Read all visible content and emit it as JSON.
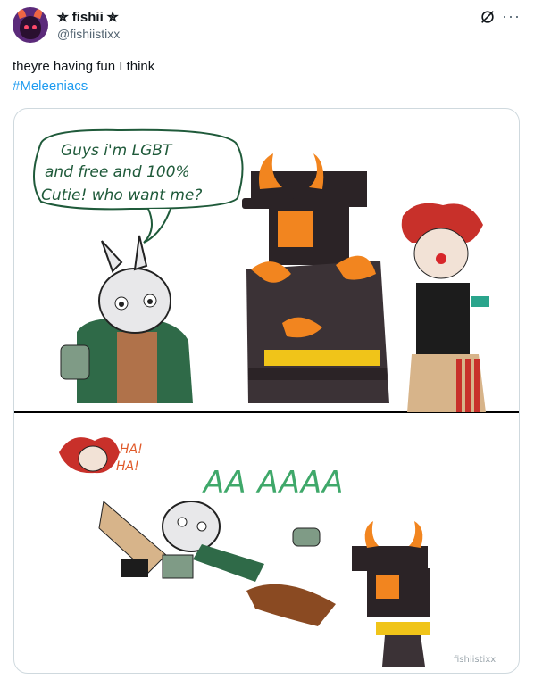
{
  "post": {
    "display_name": "✯ fishii ✯",
    "handle": "@fishiistixx",
    "text": "theyre having fun I think",
    "hashtag": "#Meleeniacs"
  },
  "media": {
    "speech_line1": "Guys i'm LGBT",
    "speech_line2": "and free and 100%",
    "speech_line3": "Cutie! who want me?",
    "laugh_1": "HA!",
    "laugh_2": "HA!",
    "scream": "AA AAAA",
    "signature": "fishiistixx"
  },
  "colors": {
    "link": "#1d9bf0",
    "secondary_text": "#536471",
    "border": "#cfd9de",
    "speech_ink": "#1f5a3a",
    "scream_green": "#3fa86a",
    "laugh_orange": "#e05a2a"
  },
  "icons": [
    "grok-icon",
    "more-icon"
  ]
}
